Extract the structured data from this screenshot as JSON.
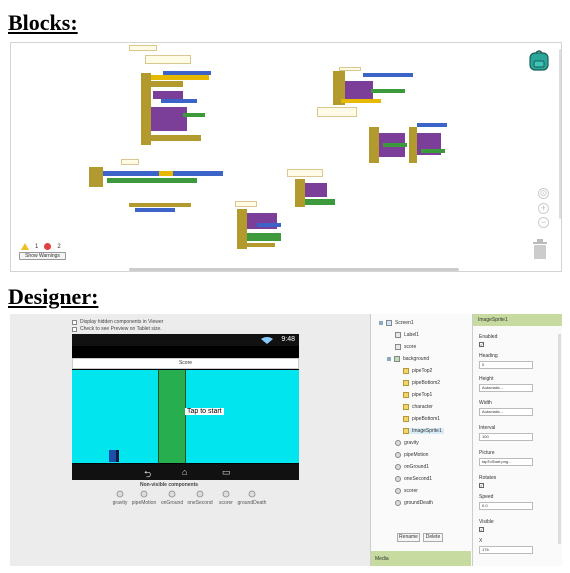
{
  "headings": {
    "blocks": "Blocks:",
    "designer": "Designer:"
  },
  "blocks_workspace": {
    "warnings_count": "1",
    "errors_count": "2",
    "show_warnings_label": "Show Warnings",
    "zoom_icons": [
      "target-icon",
      "zoom-in-icon",
      "zoom-out-icon"
    ],
    "colors": {
      "event": "#b29a2e",
      "control": "#e6b800",
      "procedure": "#7b3f99",
      "variable": "#3c64c8",
      "math": "#3c9a3c"
    }
  },
  "viewer": {
    "hidden_components_label": "Display hidden components in Viewer",
    "tablet_label": "Check to see Preview on Tablet size.",
    "status_time": "9:48",
    "screen_title": "Score",
    "tap_label": "Tap to start",
    "nonvisible_title": "Non-visible components",
    "nonvisible": [
      "gravity",
      "pipeMotion",
      "onGround",
      "oneSecond",
      "scorer",
      "groundDeath"
    ],
    "colors": {
      "canvas": "#00e5ee",
      "pipe": "#27ae4e",
      "character": "#1e4fa8"
    }
  },
  "components": {
    "screen": "Screen1",
    "label1": "Label1",
    "score": "score",
    "canvas": "background",
    "sprites": [
      "pipeTop2",
      "pipeBottom2",
      "pipeTop1",
      "character",
      "pipeBottom1",
      "ImageSprite1"
    ],
    "others": [
      "gravity",
      "pipeMotion",
      "onGround1",
      "oneSecond1",
      "scorer",
      "groundDeath"
    ],
    "rename_label": "Rename",
    "delete_label": "Delete",
    "media_label": "Media"
  },
  "properties": {
    "header": "ImageSprite1",
    "enabled_label": "Enabled",
    "heading_label": "Heading",
    "heading_value": "0",
    "height_label": "Height",
    "height_value": "Automatic...",
    "width_label": "Width",
    "width_value": "Automatic...",
    "interval_label": "Interval",
    "interval_value": "100",
    "picture_label": "Picture",
    "picture_value": "tapToStart.png...",
    "rotates_label": "Rotates",
    "speed_label": "Speed",
    "speed_value": "0.0",
    "visible_label": "Visible",
    "x_label": "X",
    "x_value": "176"
  }
}
